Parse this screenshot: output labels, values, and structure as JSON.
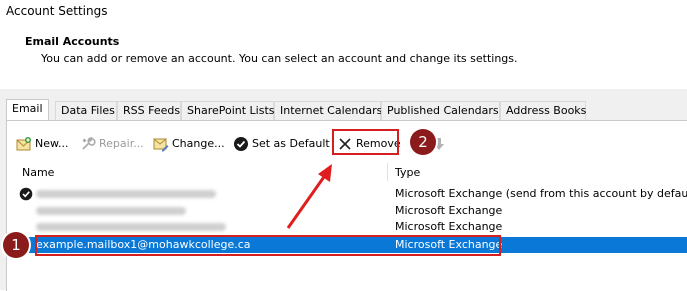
{
  "window": {
    "title": "Account Settings"
  },
  "section": {
    "title": "Email Accounts",
    "description": "You can add or remove an account. You can select an account and change its settings."
  },
  "tabs": [
    {
      "label": "Email"
    },
    {
      "label": "Data Files"
    },
    {
      "label": "RSS Feeds"
    },
    {
      "label": "SharePoint Lists"
    },
    {
      "label": "Internet Calendars"
    },
    {
      "label": "Published Calendars"
    },
    {
      "label": "Address Books"
    }
  ],
  "toolbar": {
    "new_label": "New...",
    "repair_label": "Repair...",
    "change_label": "Change...",
    "default_label": "Set as Default",
    "remove_label": "Remove"
  },
  "list": {
    "columns": {
      "name": "Name",
      "type": "Type"
    },
    "rows": [
      {
        "name": "",
        "type": "Microsoft Exchange (send from this account by default)",
        "default": true,
        "blurred": true
      },
      {
        "name": "",
        "type": "Microsoft Exchange",
        "blurred": true
      },
      {
        "name": "",
        "type": "Microsoft Exchange",
        "blurred": true
      },
      {
        "name": "example.mailbox1@mohawkcollege.ca",
        "type": "Microsoft Exchange",
        "selected": true
      }
    ]
  },
  "callouts": {
    "one": "1",
    "two": "2"
  },
  "colors": {
    "selection": "#0a78d7",
    "highlight": "#d41f1f",
    "callout": "#8b1a1a"
  }
}
